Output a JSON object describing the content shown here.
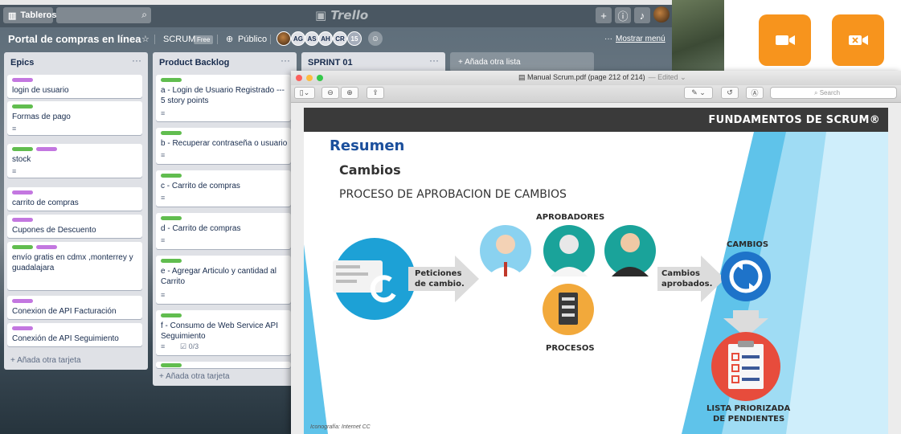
{
  "trello": {
    "boards_label": "Tableros",
    "logo": "Trello",
    "board": {
      "title": "Portal de compras en línea",
      "team": "SCRUM",
      "team_plan": "Free",
      "visibility": "Público",
      "members": [
        "AG",
        "AS",
        "AH",
        "CR"
      ],
      "member_count": "15",
      "menu_label": "Mostrar menú",
      "add_list": "+ Añada otra lista"
    },
    "lists": [
      {
        "title": "Epics",
        "add_card": "+ Añada otra tarjeta",
        "cards": [
          {
            "text": "login de usuario"
          },
          {
            "text": "Formas de pago"
          },
          {
            "text": "stock"
          },
          {
            "text": "carrito de compras"
          },
          {
            "text": "Cupones de Descuento"
          },
          {
            "text": "envío gratis en cdmx ,monterrey y guadalajara"
          },
          {
            "text": "Conexion de API Facturación"
          },
          {
            "text": "Conexión de API Seguimiento"
          }
        ]
      },
      {
        "title": "Product Backlog",
        "add_card": "+ Añada otra tarjeta",
        "cards": [
          {
            "text": "a - Login de Usuario Registrado --- 5 story points"
          },
          {
            "text": "b - Recuperar contraseña o usuario"
          },
          {
            "text": "c - Carrito de compras"
          },
          {
            "text": "d - Carrito de compras"
          },
          {
            "text": "e - Agregar Articulo y cantidad al Carrito"
          },
          {
            "text": "f - Consumo de Web Service API Seguimiento",
            "checklist": "0/3"
          }
        ]
      },
      {
        "title": "SPRINT 01"
      }
    ]
  },
  "preview": {
    "title": "Manual Scrum.pdf (page 212 of 214)",
    "edited": "— Edited ⌄",
    "search_placeholder": "Search",
    "slide": {
      "brand": "FUNDAMENTOS DE SCRUM®",
      "heading": "Resumen",
      "section": "Cambios",
      "subtitle": "PROCESO DE APROBACION DE CAMBIOS",
      "approvers": "APROBADORES",
      "requests_line1": "Peticiones",
      "requests_line2": "de cambio.",
      "approved_line1": "Cambios",
      "approved_line2": "aprobados.",
      "changes": "CAMBIOS",
      "processes": "PROCESOS",
      "list_line1": "LISTA PRIORIZADA",
      "list_line2": "DE PENDIENTES",
      "credit": "Iconografía: Internet CC"
    }
  },
  "colors": {
    "zoom_orange": "#f7941d",
    "slide_blue": "#1b4f9c",
    "label_green": "#61bd4f",
    "label_purple": "#c377e0"
  }
}
